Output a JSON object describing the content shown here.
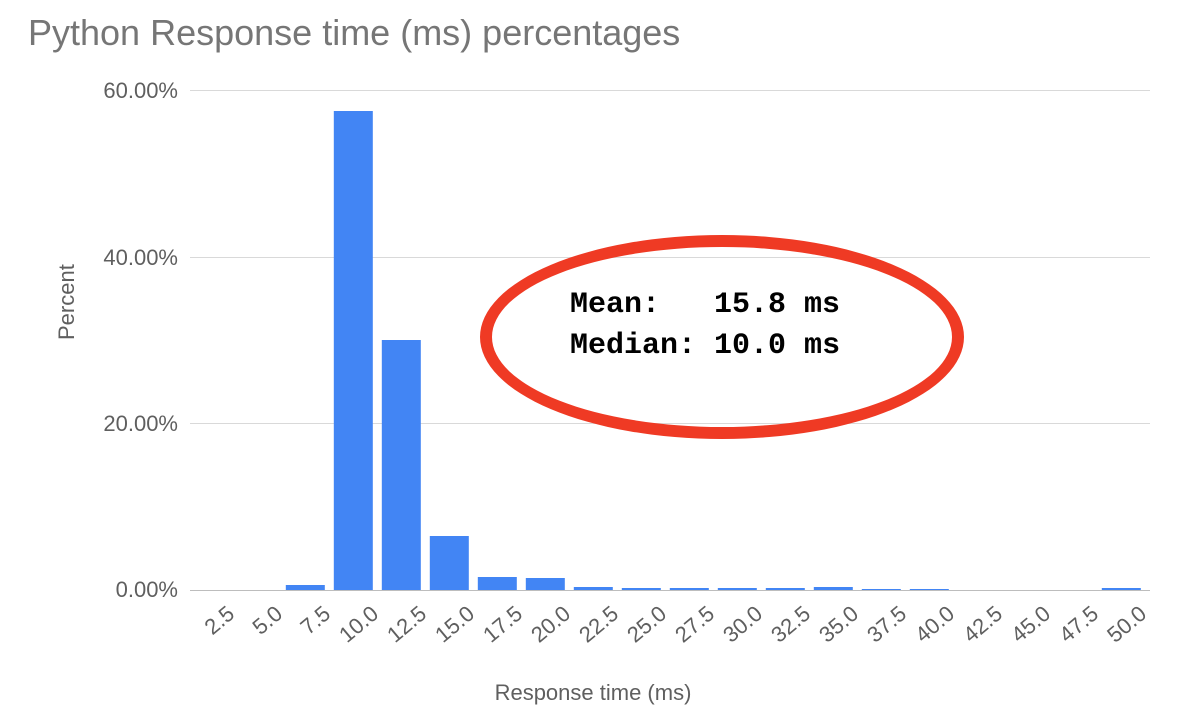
{
  "chart_data": {
    "type": "bar",
    "title": "Python Response time (ms) percentages",
    "xlabel": "Response time (ms)",
    "ylabel": "Percent",
    "categories": [
      "2.5",
      "5.0",
      "7.5",
      "10.0",
      "12.5",
      "15.0",
      "17.5",
      "20.0",
      "22.5",
      "25.0",
      "27.5",
      "30.0",
      "32.5",
      "35.0",
      "37.5",
      "40.0",
      "42.5",
      "45.0",
      "47.5",
      "50.0"
    ],
    "values": [
      0.0,
      0.0,
      0.6,
      57.5,
      30.0,
      6.5,
      1.6,
      1.4,
      0.4,
      0.2,
      0.2,
      0.2,
      0.2,
      0.4,
      0.1,
      0.1,
      0.0,
      0.0,
      0.0,
      0.2
    ],
    "ylim": [
      0,
      60
    ],
    "y_ticks": [
      0,
      20,
      40,
      60
    ],
    "y_tick_labels": [
      "0.00%",
      "20.00%",
      "40.00%",
      "60.00%"
    ],
    "annotation": {
      "mean_label": "Mean:",
      "mean_value": "15.8 ms",
      "median_label": "Median:",
      "median_value": "10.0 ms"
    },
    "colors": {
      "bar": "#4285f4",
      "ellipse": "#ef3a24",
      "title": "#767676",
      "axis_text": "#5f5f5f"
    }
  }
}
